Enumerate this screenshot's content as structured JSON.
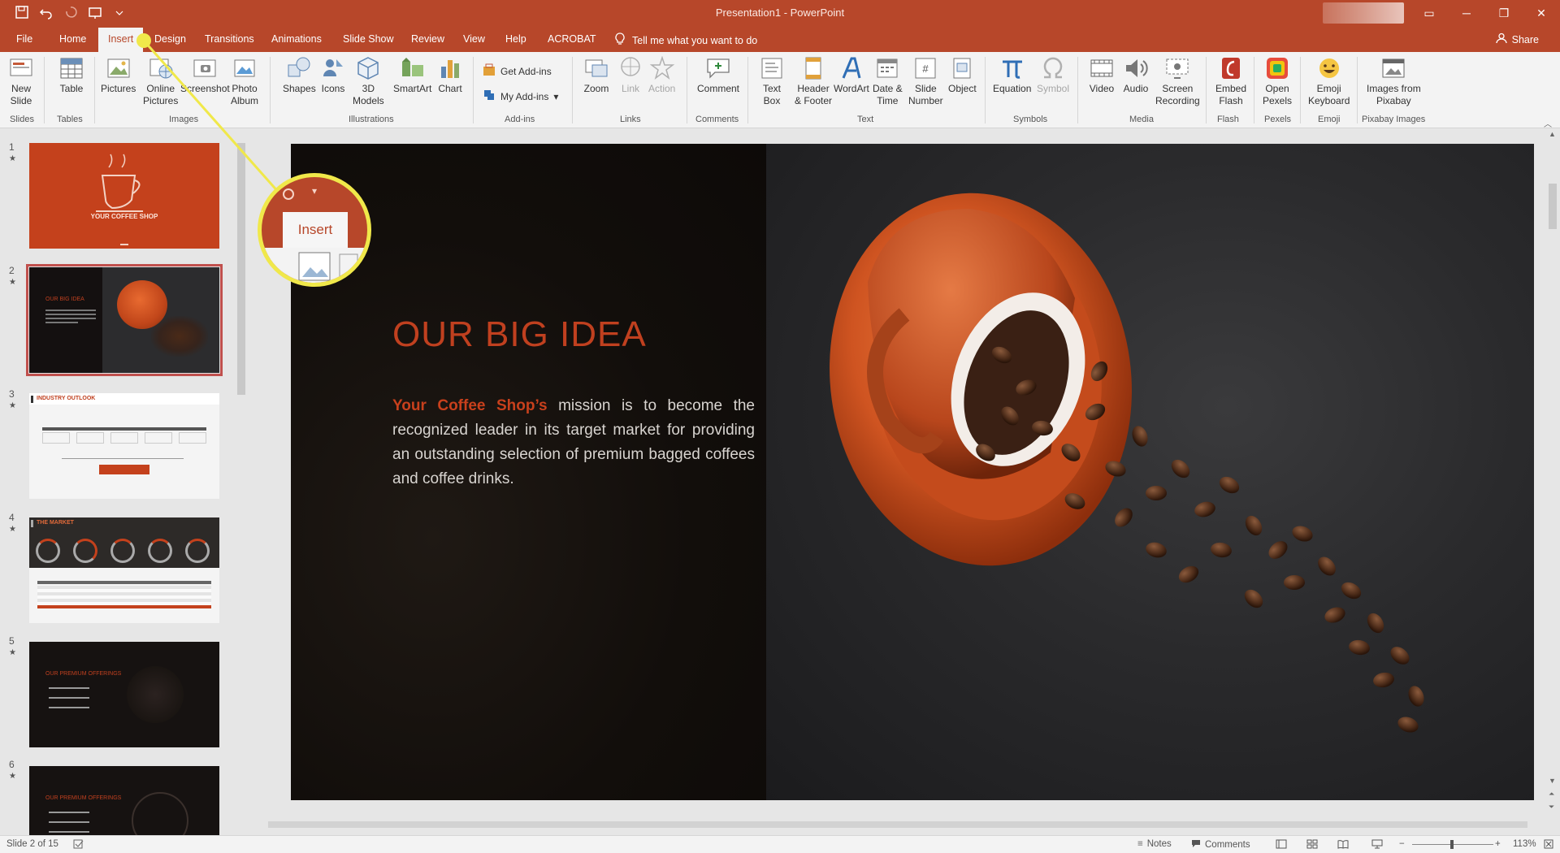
{
  "window": {
    "title": "Presentation1  -  PowerPoint"
  },
  "tabs": [
    "File",
    "Home",
    "Insert",
    "Design",
    "Transitions",
    "Animations",
    "Slide Show",
    "Review",
    "View",
    "Help",
    "ACROBAT"
  ],
  "active_tab": "Insert",
  "tell_me": "Tell me what you want to do",
  "share": "Share",
  "ribbon": {
    "new_slide": [
      "New",
      "Slide"
    ],
    "table": "Table",
    "pictures": "Pictures",
    "online_pictures": [
      "Online",
      "Pictures"
    ],
    "screenshot": "Screenshot",
    "photo_album": [
      "Photo",
      "Album"
    ],
    "shapes": "Shapes",
    "icons": "Icons",
    "models_3d": [
      "3D",
      "Models"
    ],
    "smartart": "SmartArt",
    "chart": "Chart",
    "get_addins": "Get Add-ins",
    "my_addins": "My Add-ins",
    "zoom": "Zoom",
    "link": "Link",
    "action": "Action",
    "comment": "Comment",
    "text_box": [
      "Text",
      "Box"
    ],
    "header_footer": [
      "Header",
      "& Footer"
    ],
    "wordart": "WordArt",
    "date_time": [
      "Date &",
      "Time"
    ],
    "slide_number": [
      "Slide",
      "Number"
    ],
    "object": "Object",
    "equation": "Equation",
    "symbol": "Symbol",
    "video": "Video",
    "audio": "Audio",
    "screen_recording": [
      "Screen",
      "Recording"
    ],
    "embed_flash": [
      "Embed",
      "Flash"
    ],
    "open_pexels": [
      "Open",
      "Pexels"
    ],
    "emoji_keyboard": [
      "Emoji",
      "Keyboard"
    ],
    "images_pixabay": [
      "Images from",
      "Pixabay"
    ],
    "groups": {
      "slides": "Slides",
      "tables": "Tables",
      "images": "Images",
      "illustrations": "Illustrations",
      "addins": "Add-ins",
      "links": "Links",
      "comments": "Comments",
      "text": "Text",
      "symbols": "Symbols",
      "media": "Media",
      "flash": "Flash",
      "pexels": "Pexels",
      "emoji": "Emoji",
      "pixabay": "Pixabay Images"
    }
  },
  "thumbnails": [
    {
      "num": "1",
      "label": "YOUR COFFEE SHOP"
    },
    {
      "num": "2",
      "label": "OUR BIG IDEA"
    },
    {
      "num": "3",
      "label": "INDUSTRY OUTLOOK"
    },
    {
      "num": "4",
      "label": "THE MARKET"
    },
    {
      "num": "5",
      "label": "OUR PREMIUM OFFERINGS"
    },
    {
      "num": "6",
      "label": "OUR PREMIUM OFFERINGS"
    }
  ],
  "slide": {
    "title": "OUR BIG IDEA",
    "body_highlight": "Your Coffee Shop’s",
    "body_rest": " mission is to become the recognized leader in its target market for providing an outstanding selection of premium bagged coffees and coffee drinks."
  },
  "magnifier": {
    "label": "Insert"
  },
  "status": {
    "slide_of": "Slide 2 of 15",
    "notes": "Notes",
    "comments": "Comments",
    "zoom": "113%"
  },
  "colors": {
    "accent": "#b7472a",
    "callout": "#f0e84a",
    "slide_title": "#c0401f"
  }
}
